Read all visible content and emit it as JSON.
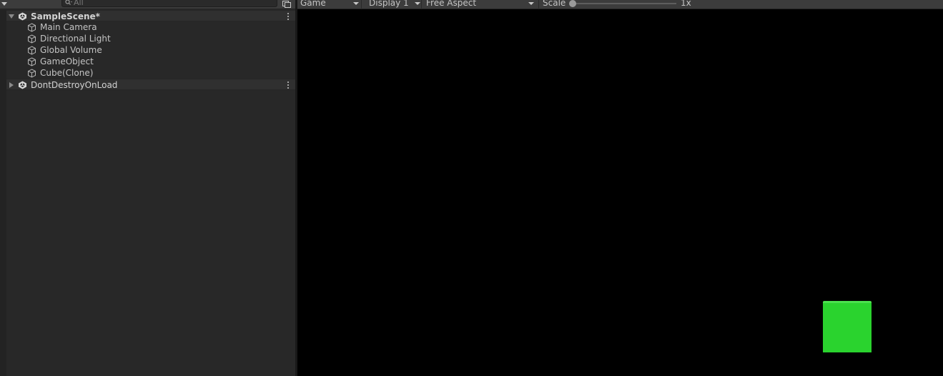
{
  "hierarchy": {
    "search": {
      "placeholder": "All",
      "value": ""
    },
    "scenes": [
      {
        "name": "SampleScene*",
        "expanded": true,
        "objects": [
          "Main Camera",
          "Directional Light",
          "Global Volume",
          "GameObject",
          "Cube(Clone)"
        ]
      },
      {
        "name": "DontDestroyOnLoad",
        "expanded": false,
        "objects": []
      }
    ]
  },
  "game": {
    "tab_label": "Game",
    "display": "Display 1",
    "aspect": "Free Aspect",
    "scale_label": "Scale",
    "scale_value": "1x",
    "cube_color": "#2ad32e",
    "background_color": "#000000"
  },
  "colors": {
    "panel_bg": "#282828",
    "toolbar_bg": "#3c3c3c",
    "text": "#c4c4c4"
  }
}
